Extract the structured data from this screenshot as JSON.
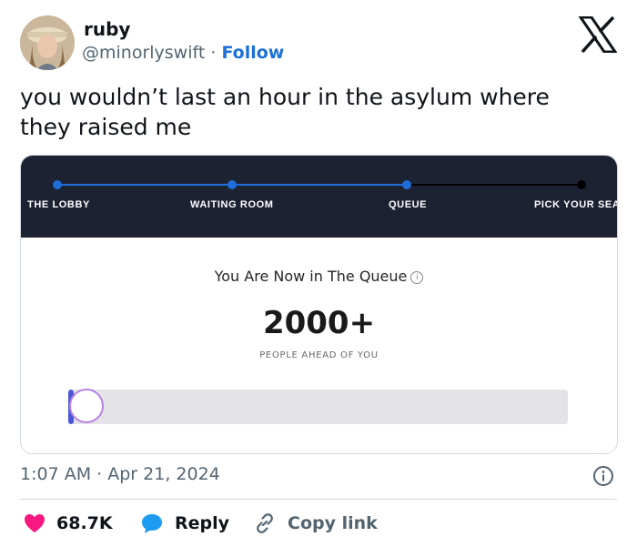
{
  "author": {
    "display_name": "ruby",
    "handle": "@minorlyswift",
    "separator": "·",
    "follow_label": "Follow"
  },
  "tweet": {
    "text": "you wouldn’t last an hour in the asylum where they raised me"
  },
  "card": {
    "steps": [
      {
        "label": "THE LOBBY",
        "done": true
      },
      {
        "label": "WAITING ROOM",
        "done": true
      },
      {
        "label": "QUEUE",
        "done": true
      },
      {
        "label": "PICK YOUR SEA",
        "done": false
      }
    ],
    "queue_title": "You Are Now in The Queue",
    "info_glyph": "i",
    "count": "2000+",
    "ahead_label": "PEOPLE AHEAD OF YOU",
    "progress_fraction": 0,
    "colors": {
      "dark_bg": "#1d2233",
      "step_active": "#1f6ddb",
      "step_inactive": "#000000",
      "progress_track": "#e4e4e6",
      "knob_border": "#b880e6"
    }
  },
  "meta": {
    "time": "1:07 AM",
    "separator": "·",
    "date": "Apr 21, 2024"
  },
  "actions": {
    "likes": "68.7K",
    "reply_label": "Reply",
    "copy_label": "Copy link"
  },
  "colors": {
    "like": "#f91880",
    "reply": "#1d9bf0",
    "link": "#1d71d6",
    "muted": "#536471"
  }
}
